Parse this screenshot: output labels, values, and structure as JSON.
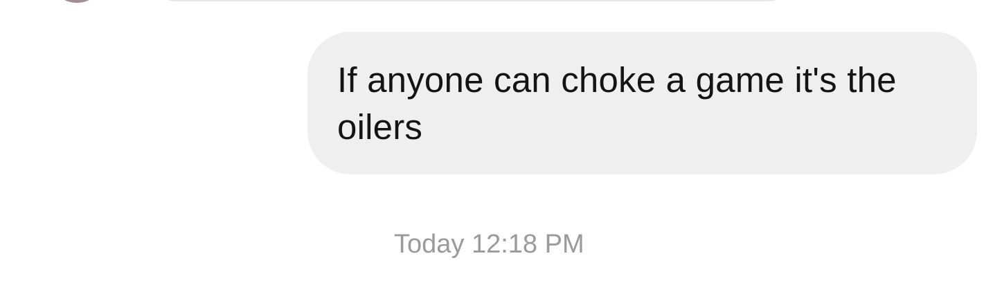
{
  "conversation": {
    "message": {
      "text": "If anyone can choke a game it's the oilers",
      "direction": "received"
    },
    "timestamp": "Today 12:18 PM"
  },
  "colors": {
    "bubble_background": "#efefef",
    "message_text": "#141414",
    "timestamp_text": "#9a9a9a",
    "page_background": "#ffffff"
  }
}
